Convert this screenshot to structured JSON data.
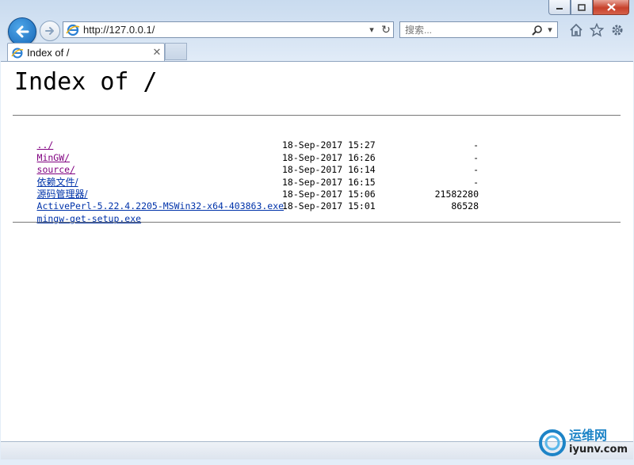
{
  "window": {
    "minimize_icon": "minimize-icon",
    "maximize_icon": "maximize-icon",
    "close_icon": "close-icon"
  },
  "nav": {
    "address_url": "http://127.0.0.1/",
    "search_placeholder": "搜索..."
  },
  "tab": {
    "title": "Index of /"
  },
  "page": {
    "heading": "Index of /",
    "entries": [
      {
        "name": "../",
        "date": "",
        "size": ""
      },
      {
        "name": "MinGW/",
        "date": "18-Sep-2017 15:27",
        "size": "-"
      },
      {
        "name": "source/",
        "date": "18-Sep-2017 16:26",
        "size": "-"
      },
      {
        "name": "依赖文件/",
        "date": "18-Sep-2017 16:14",
        "size": "-"
      },
      {
        "name": "源码管理器/",
        "date": "18-Sep-2017 16:15",
        "size": "-"
      },
      {
        "name": "ActivePerl-5.22.4.2205-MSWin32-x64-403863.exe",
        "date": "18-Sep-2017 15:06",
        "size": "21582280"
      },
      {
        "name": "mingw-get-setup.exe",
        "date": "18-Sep-2017 15:01",
        "size": "86528"
      }
    ]
  },
  "watermark": {
    "line1": "运维网",
    "line2": "iyunv.com"
  },
  "colors": {
    "link": "#0033aa",
    "visited": "#800080",
    "accent": "#1666b6"
  }
}
